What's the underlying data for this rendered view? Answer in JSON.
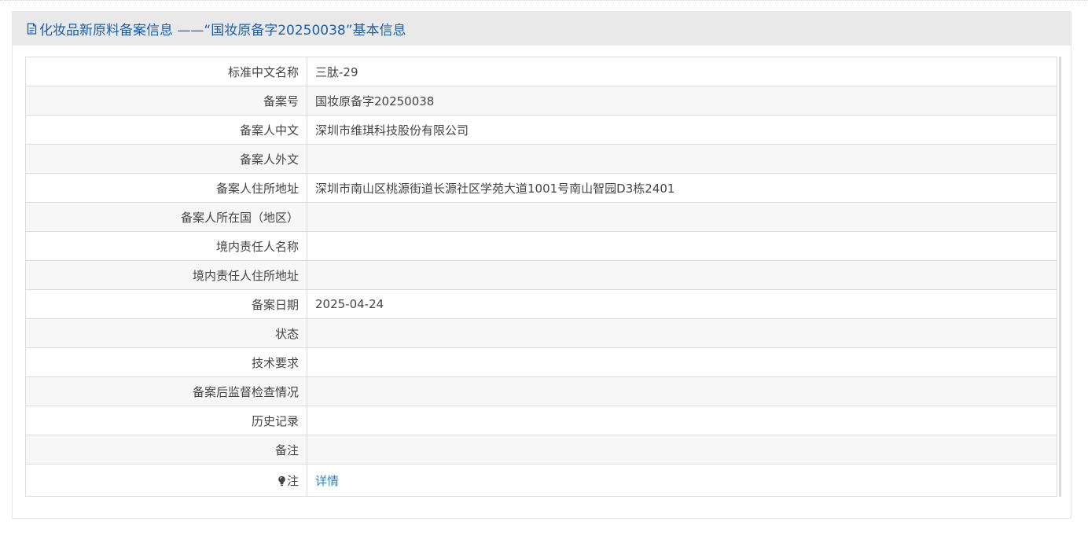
{
  "header": {
    "title": "化妆品新原料备案信息 ——“国妆原备字20250038”基本信息",
    "icon": "document-icon"
  },
  "rows": [
    {
      "label": "标准中文名称",
      "value": "三肽-29"
    },
    {
      "label": "备案号",
      "value": "国妆原备字20250038"
    },
    {
      "label": "备案人中文",
      "value": "深圳市维琪科技股份有限公司"
    },
    {
      "label": "备案人外文",
      "value": ""
    },
    {
      "label": "备案人住所地址",
      "value": "深圳市南山区桃源街道长源社区学苑大道1001号南山智园D3栋2401"
    },
    {
      "label": "备案人所在国（地区）",
      "value": ""
    },
    {
      "label": "境内责任人名称",
      "value": ""
    },
    {
      "label": "境内责任人住所地址",
      "value": ""
    },
    {
      "label": "备案日期",
      "value": "2025-04-24"
    },
    {
      "label": "状态",
      "value": ""
    },
    {
      "label": "技术要求",
      "value": ""
    },
    {
      "label": "备案后监督检查情况",
      "value": ""
    },
    {
      "label": "历史记录",
      "value": ""
    },
    {
      "label": "备注",
      "value": ""
    }
  ],
  "note": {
    "label": "注",
    "icon": "lightbulb-icon",
    "link": "详情"
  },
  "colors": {
    "accent": "#1c5fa8",
    "link": "#2a85c9",
    "header_bg": "#e9e9e9",
    "stripe": "#f7f7f7"
  }
}
